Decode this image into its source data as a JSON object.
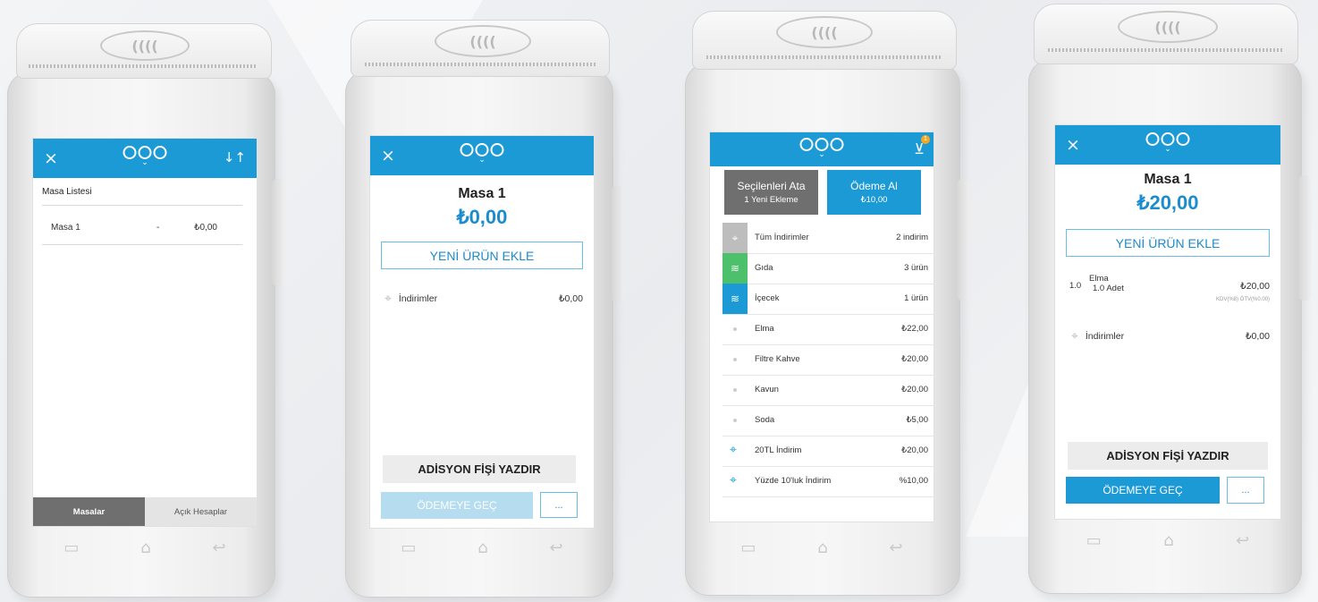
{
  "nfc_symbol": "((((",
  "nav": {
    "recent": "▭",
    "home": "⌂",
    "back": "↩"
  },
  "screen1": {
    "close": "×",
    "sort_icon": "↓↑",
    "list_title": "Masa Listesi",
    "table_name": "Masa 1",
    "table_dash": "-",
    "table_amount": "₺0,00",
    "tab_tables": "Masalar",
    "tab_open": "Açık Hesaplar"
  },
  "screen2": {
    "close": "×",
    "title": "Masa 1",
    "amount": "₺0,00",
    "add_button": "YENİ ÜRÜN EKLE",
    "discounts_label": "İndirimler",
    "discounts_value": "₺0,00",
    "print_button": "ADİSYON FİŞİ YAZDIR",
    "pay_button": "ÖDEMEYE GEÇ",
    "more_button": "..."
  },
  "screen3": {
    "cart_badge": "1",
    "assign_title": "Seçilenleri Ata",
    "assign_sub": "1 Yeni Ekleme",
    "pay_title": "Ödeme Al",
    "pay_sub": "₺10,00",
    "rows": [
      {
        "label": "Tüm İndirimler",
        "value": "2 indirim",
        "kind": "icon",
        "color": "#bdbdbd",
        "icon": "⌖"
      },
      {
        "label": "Gıda",
        "value": "3 ürün",
        "kind": "icon",
        "color": "#4cc06a",
        "icon": "≋"
      },
      {
        "label": "İçecek",
        "value": "1 ürün",
        "kind": "icon",
        "color": "#1b9ad6",
        "icon": "≋"
      },
      {
        "label": "Elma",
        "value": "₺22,00",
        "kind": "dot"
      },
      {
        "label": "Filtre Kahve",
        "value": "₺20,00",
        "kind": "dot"
      },
      {
        "label": "Kavun",
        "value": "₺20,00",
        "kind": "dot"
      },
      {
        "label": "Soda",
        "value": "₺5,00",
        "kind": "dot"
      },
      {
        "label": "20TL İndirim",
        "value": "₺20,00",
        "kind": "tag"
      },
      {
        "label": "Yüzde 10'luk İndirim",
        "value": "%10,00",
        "kind": "tag"
      }
    ]
  },
  "screen4": {
    "close": "×",
    "title": "Masa 1",
    "amount": "₺20,00",
    "add_button": "YENİ ÜRÜN EKLE",
    "item_qty": "1.0",
    "item_name": "Elma",
    "item_sub": "1.0 Adet",
    "item_price": "₺20,00",
    "item_tax": "KDV(%8) ÖTV(%0.00)",
    "discounts_label": "İndirimler",
    "discounts_value": "₺0,00",
    "print_button": "ADİSYON FİŞİ YAZDIR",
    "pay_button": "ÖDEMEYE GEÇ",
    "more_button": "..."
  }
}
